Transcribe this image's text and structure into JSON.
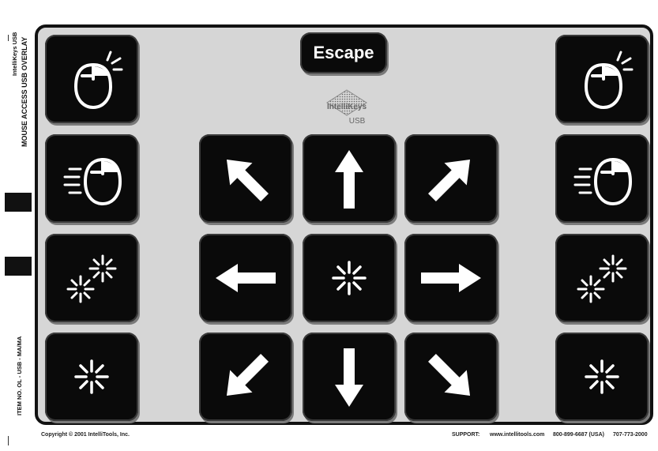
{
  "sidebar": {
    "brand": "IntelliKeys USB",
    "overlay_title": "MOUSE ACCESS USB  OVERLAY",
    "item_no": "ITEM NO. OL - USB - MA/MA"
  },
  "escape_label": "Escape",
  "logo": {
    "word": "IntelliKeys",
    "sub": "USB"
  },
  "footer": {
    "copyright": "Copyright © 2001 IntelliTools, Inc.",
    "support_label": "SUPPORT:",
    "website": "www.intellitools.com",
    "phone": "800-899-6687 (USA)",
    "phone_intl": "707-773-2000"
  },
  "keys": [
    {
      "id": "click-left",
      "icon": "mouse-click-icon"
    },
    {
      "id": "click-right",
      "icon": "mouse-click-icon"
    },
    {
      "id": "drag-left",
      "icon": "mouse-drag-icon"
    },
    {
      "id": "up-left",
      "icon": "arrow-up-left-icon"
    },
    {
      "id": "up",
      "icon": "arrow-up-icon"
    },
    {
      "id": "up-right",
      "icon": "arrow-up-right-icon"
    },
    {
      "id": "drag-right",
      "icon": "mouse-drag-icon"
    },
    {
      "id": "double-click-left",
      "icon": "double-click-icon"
    },
    {
      "id": "left",
      "icon": "arrow-left-icon"
    },
    {
      "id": "center",
      "icon": "click-burst-icon"
    },
    {
      "id": "right",
      "icon": "arrow-right-icon"
    },
    {
      "id": "double-click-right",
      "icon": "double-click-icon"
    },
    {
      "id": "single-click-left",
      "icon": "click-burst-icon"
    },
    {
      "id": "down-left",
      "icon": "arrow-down-left-icon"
    },
    {
      "id": "down",
      "icon": "arrow-down-icon"
    },
    {
      "id": "down-right",
      "icon": "arrow-down-right-icon"
    },
    {
      "id": "single-click-right",
      "icon": "click-burst-icon"
    }
  ],
  "colors": {
    "key_fill": "#0a0a0a",
    "board": "#d6d6d6",
    "glyph": "#ffffff"
  }
}
